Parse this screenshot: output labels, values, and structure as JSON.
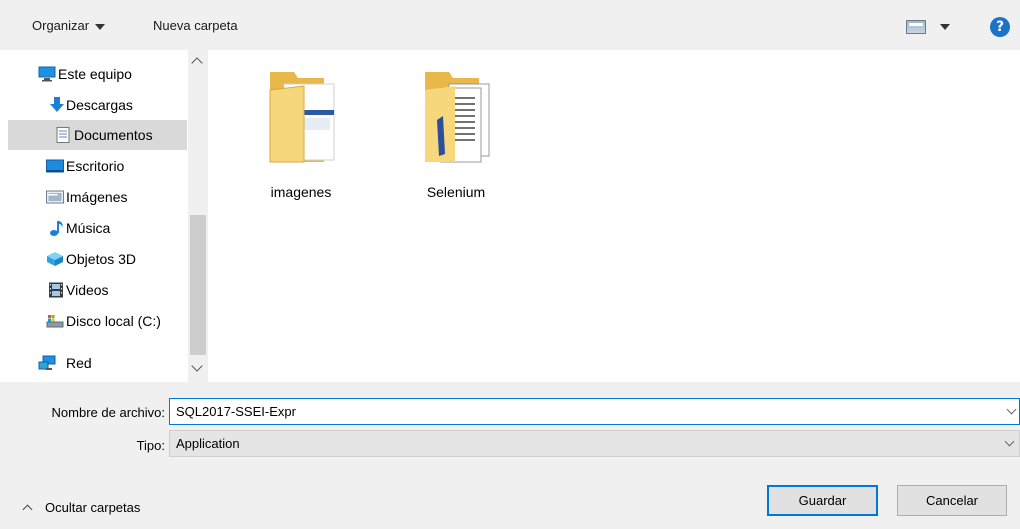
{
  "toolbar": {
    "organizar_label": "Organizar",
    "nueva_carpeta_label": "Nueva carpeta",
    "view_icon": "view-options-icon",
    "help_icon": "help-icon",
    "help_glyph": "?"
  },
  "nav": {
    "items": [
      {
        "label": "Este equipo",
        "icon": "computer-icon"
      },
      {
        "label": "Descargas",
        "icon": "download-icon"
      },
      {
        "label": "Documentos",
        "icon": "documents-icon",
        "selected": true
      },
      {
        "label": "Escritorio",
        "icon": "desktop-icon"
      },
      {
        "label": "Imágenes",
        "icon": "pictures-icon"
      },
      {
        "label": "Música",
        "icon": "music-icon"
      },
      {
        "label": "Objetos 3D",
        "icon": "3d-objects-icon"
      },
      {
        "label": "Videos",
        "icon": "videos-icon"
      },
      {
        "label": "Disco local (C:)",
        "icon": "drive-icon"
      },
      {
        "label": "Red",
        "icon": "network-icon"
      }
    ]
  },
  "content": {
    "folders": [
      {
        "name": "imagenes"
      },
      {
        "name": "Selenium"
      }
    ]
  },
  "form": {
    "nombre_label": "Nombre de archivo:",
    "nombre_value": "SQL2017-SSEI-Expr",
    "tipo_label": "Tipo:",
    "tipo_value": "Application"
  },
  "footer": {
    "hide_folders_label": "Ocultar carpetas",
    "save_label": "Guardar",
    "cancel_label": "Cancelar"
  },
  "colors": {
    "accent": "#0078d7",
    "selected_bg": "#cce4f7",
    "panel_bg": "#f0f0f0"
  }
}
